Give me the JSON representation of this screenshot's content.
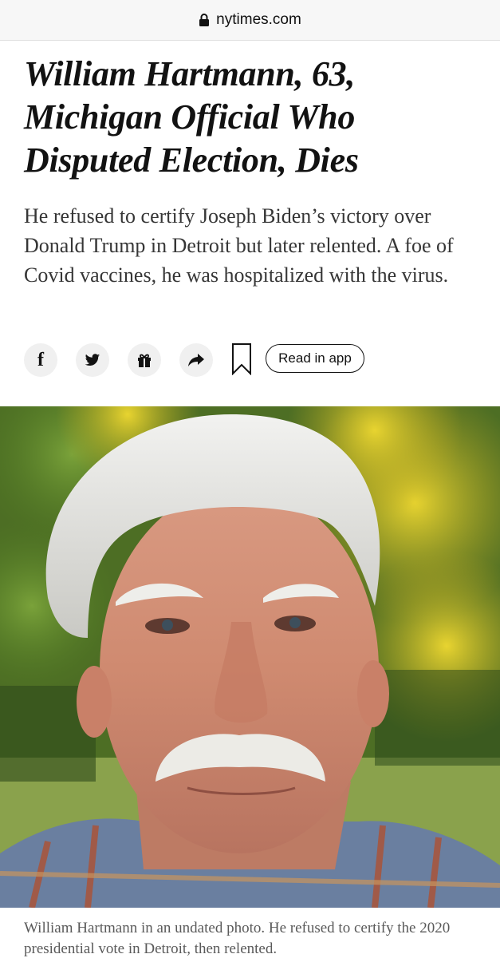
{
  "browser": {
    "url": "nytimes.com"
  },
  "article": {
    "headline_lines": [
      "William Hartmann, 63,",
      "Michigan Official Who",
      "Disputed Election, Dies"
    ],
    "summary": "He refused to certify Joseph Biden’s victory over Donald Trump in Detroit but later relented. A foe of Covid vaccines, he was hospitalized with the virus.",
    "caption": "William Hartmann in an undated photo. He refused to certify the 2020 presidential vote in Detroit, then relented."
  },
  "share": {
    "facebook_glyph": "f",
    "read_in_app_label": "Read in app",
    "icons": [
      "facebook-icon",
      "twitter-icon",
      "gift-icon",
      "share-arrow-icon",
      "bookmark-icon"
    ]
  },
  "colors": {
    "text": "#121212",
    "summary_text": "#363636",
    "caption_text": "#5a5a5a",
    "button_bg": "#f0f0f0",
    "urlbar_bg": "#f7f7f7"
  }
}
